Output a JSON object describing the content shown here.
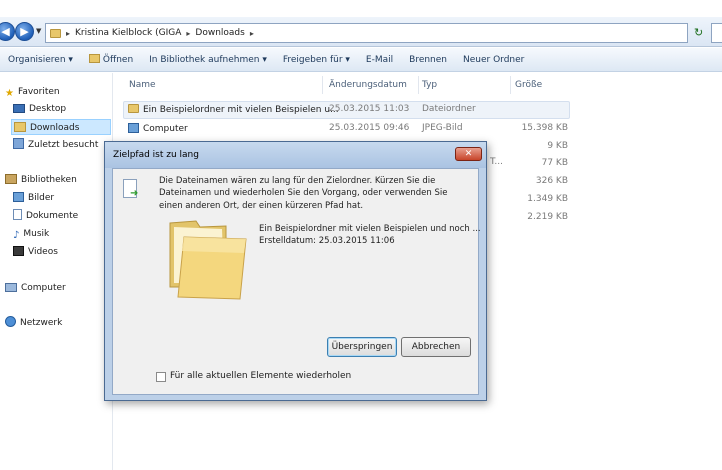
{
  "address": {
    "crumbs": [
      "Kristina Kielblock (GIGA",
      "Downloads"
    ]
  },
  "toolbar": {
    "organize": "Organisieren ▾",
    "open": "Öffnen",
    "include_library": "In Bibliothek aufnehmen ▾",
    "share": "Freigeben für ▾",
    "email": "E-Mail",
    "burn": "Brennen",
    "new_folder": "Neuer Ordner"
  },
  "nav": {
    "favorites": "Favoriten",
    "desktop": "Desktop",
    "downloads": "Downloads",
    "recent": "Zuletzt besucht",
    "libraries": "Bibliotheken",
    "pictures": "Bilder",
    "documents": "Dokumente",
    "music": "Musik",
    "videos": "Videos",
    "computer": "Computer",
    "network": "Netzwerk"
  },
  "columns": {
    "name": "Name",
    "date": "Änderungsdatum",
    "type": "Typ",
    "size": "Größe"
  },
  "files": [
    {
      "name": "Ein Beispielordner mit vielen Beispielen u...",
      "date": "25.03.2015 11:03",
      "type": "Dateiordner",
      "size": ""
    },
    {
      "name": "Computer",
      "date": "25.03.2015 09:46",
      "type": "JPEG-Bild",
      "size": "15.398 KB"
    }
  ],
  "hidden_rows": [
    {
      "type": "T...",
      "size": "9 KB"
    },
    {
      "type": "",
      "size": "77 KB"
    },
    {
      "type": "",
      "size": "326 KB"
    },
    {
      "type": "",
      "size": "1.349 KB"
    },
    {
      "type": "",
      "size": "2.219 KB"
    }
  ],
  "dialog": {
    "title": "Zielpfad ist zu lang",
    "close": "✕",
    "message": "Die Dateinamen wären zu lang für den Zielordner. Kürzen Sie die Dateinamen und wiederholen Sie den Vorgang, oder verwenden Sie einen anderen Ort, der einen kürzeren Pfad hat.",
    "item_name": "Ein Beispielordner mit vielen Beispielen und noch ...",
    "item_date": "Erstelldatum: 25.03.2015 11:06",
    "skip_button": "Überspringen",
    "cancel_button": "Abbrechen",
    "checkbox_label": "Für alle aktuellen Elemente wiederholen"
  }
}
